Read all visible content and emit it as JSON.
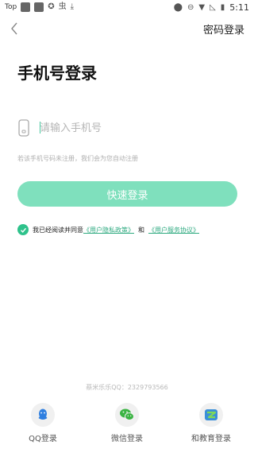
{
  "status_bar": {
    "carrier": "Top",
    "time": "5:11"
  },
  "header": {
    "password_login": "密码登录"
  },
  "title": "手机号登录",
  "phone": {
    "placeholder": "请输入手机号",
    "value": ""
  },
  "hint": "若该手机号码未注册，我们会为您自动注册",
  "quick_login": "快速登录",
  "agreement": {
    "prefix": "我已经阅读并同意",
    "privacy": "《用户隐私政策》",
    "and": "和",
    "service": "《用户服务协议》"
  },
  "qq_number": "蔡米乐乐QQ：2329793566",
  "social": [
    {
      "label": "QQ登录",
      "icon": "qq-icon"
    },
    {
      "label": "微信登录",
      "icon": "wechat-icon"
    },
    {
      "label": "和教育登录",
      "icon": "hejiaoyu-icon"
    }
  ],
  "colors": {
    "accent": "#7fe0bd",
    "check": "#2ec28b",
    "link": "#2eaa80"
  }
}
